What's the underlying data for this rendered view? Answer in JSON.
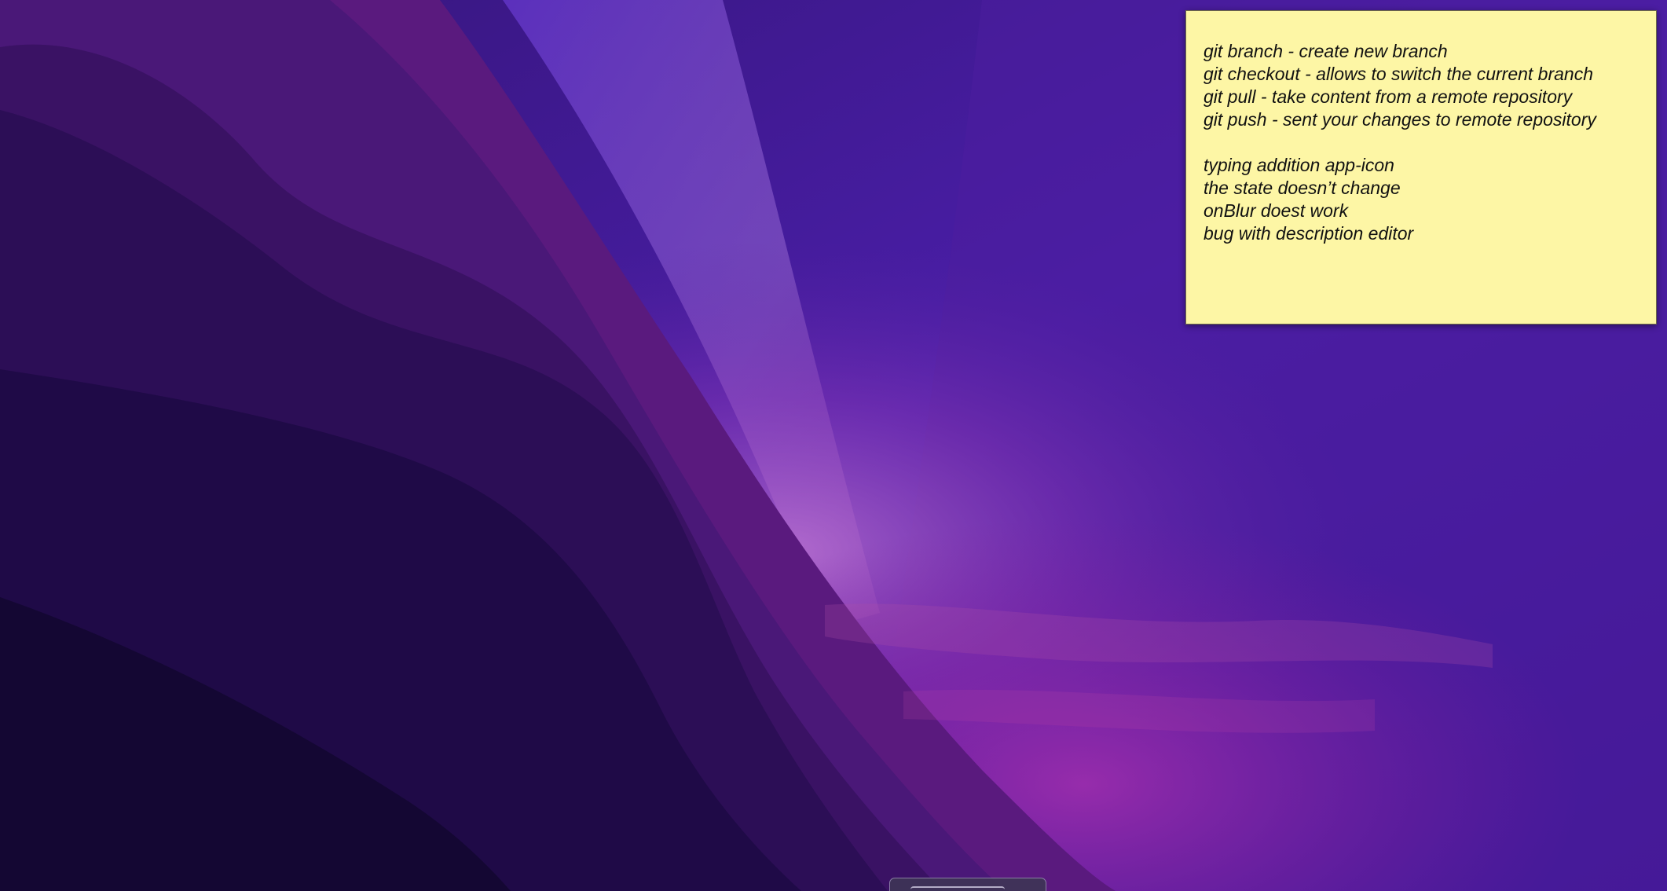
{
  "desktop": {
    "wallpaper_name": "monterey-purple-wallpaper",
    "colors": {
      "deep": "#130833",
      "mid": "#3a1470",
      "violet": "#4a1fb0",
      "magenta": "#9a2fa8",
      "glow": "#c77ad6"
    }
  },
  "sticky_note": {
    "background": "#fdf6a5",
    "lines": [
      "git branch - create new branch",
      "git checkout - allows to switch the current branch",
      "git pull - take content from a remote repository",
      "git push - sent your changes to remote repository",
      "",
      "typing addition app-icon",
      "the state doesn’t change",
      "onBlur doest work",
      "bug with description editor"
    ]
  }
}
